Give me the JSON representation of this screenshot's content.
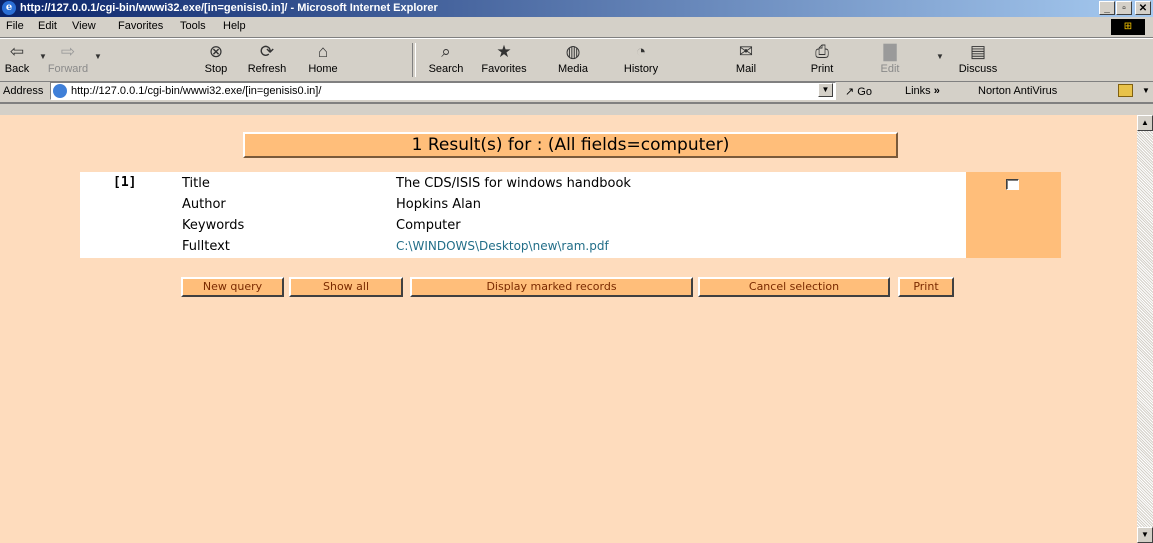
{
  "window": {
    "title": "http://127.0.0.1/cgi-bin/wwwi32.exe/[in=genisis0.in]/ - Microsoft Internet Explorer"
  },
  "menu": {
    "items": [
      "File",
      "Edit",
      "View",
      "Favorites",
      "Tools",
      "Help"
    ]
  },
  "toolbar": {
    "back": "Back",
    "forward": "Forward",
    "stop": "Stop",
    "refresh": "Refresh",
    "home": "Home",
    "search": "Search",
    "favorites": "Favorites",
    "media": "Media",
    "history": "History",
    "mail": "Mail",
    "print": "Print",
    "edit": "Edit",
    "discuss": "Discuss"
  },
  "address": {
    "label": "Address",
    "url": "http://127.0.0.1/cgi-bin/wwwi32.exe/[in=genisis0.in]/",
    "go": "Go",
    "links": "Links",
    "norton": "Norton AntiVirus"
  },
  "page": {
    "header": "1 Result(s) for : (All fields=computer)",
    "result": {
      "number": "[1]",
      "fields": [
        {
          "label": "Title",
          "value": "The CDS/ISIS for windows handbook"
        },
        {
          "label": "Author",
          "value": "Hopkins Alan"
        },
        {
          "label": "Keywords",
          "value": "Computer"
        },
        {
          "label": "Fulltext",
          "value": "C:\\WINDOWS\\Desktop\\new\\ram.pdf"
        }
      ],
      "marked": false
    },
    "buttons": {
      "new_query": "New query",
      "show_all": "Show all",
      "display_marked": "Display marked records",
      "cancel_selection": "Cancel selection",
      "print": "Print"
    }
  },
  "colors": {
    "page_bg": "#fedcbd",
    "accent": "#ffbe7a",
    "link": "#226e88",
    "titlebar": "#0a246a"
  }
}
